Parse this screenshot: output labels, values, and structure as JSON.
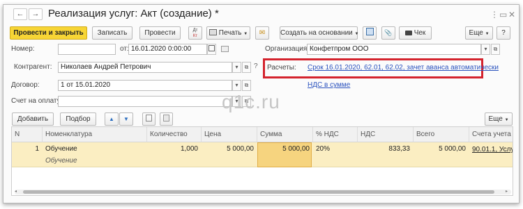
{
  "window": {
    "title": "Реализация услуг: Акт (создание) *",
    "nav_back": "←",
    "nav_forward": "→",
    "nav_star": "☆",
    "menu_icon": "⋮",
    "restore_icon": "▭",
    "close_icon": "✕"
  },
  "toolbar": {
    "post_close": "Провести и закрыть",
    "save": "Записать",
    "post": "Провести",
    "dtkt_top": "Дт",
    "dtkt_bottom": "Кт",
    "print": "Печать",
    "mail_icon": "✉",
    "create_based": "Создать на основании",
    "clip_icon": "📎",
    "check": "Чек",
    "more": "Еще",
    "help": "?"
  },
  "form": {
    "number_label": "Номер:",
    "number_value": "",
    "date_label": "от:",
    "date_value": "16.01.2020  0:00:00",
    "org_label": "Организация:",
    "org_value": "Конфетпром ООО",
    "counterparty_label": "Контрагент:",
    "counterparty_value": "Николаев Андрей Петрович",
    "settlements_label": "Расчеты:",
    "settlements_link": "Срок 16.01.2020, 62.01, 62.02, зачет аванса автоматически",
    "vat_link": "НДС в сумме",
    "contract_label": "Договор:",
    "contract_value": "1 от 15.01.2020",
    "invoice_label": "Счет на оплату:",
    "invoice_value": "",
    "watermark": "q1c.ru"
  },
  "table_toolbar": {
    "add": "Добавить",
    "select": "Подбор",
    "up": "▲",
    "down": "▼",
    "more": "Еще"
  },
  "table": {
    "columns": [
      "N",
      "Номенклатура",
      "Количество",
      "Цена",
      "Сумма",
      "% НДС",
      "НДС",
      "Всего",
      "Счета учета"
    ],
    "rows": [
      {
        "n": "1",
        "item": "Обучение",
        "item_sub": "Обучение",
        "qty": "1,000",
        "price": "5 000,00",
        "sum": "5 000,00",
        "vat_rate": "20%",
        "vat": "833,33",
        "total": "5 000,00",
        "account": "90.01.1, Услу"
      }
    ]
  },
  "colors": {
    "accent": "#f7d535",
    "highlight_row": "#fbeec2",
    "selected_cell": "#f6d47f",
    "link": "#2a52be",
    "red_frame": "#d4232d"
  }
}
